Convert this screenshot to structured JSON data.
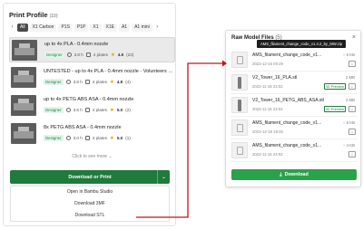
{
  "print_profile": {
    "title": "Print Profile",
    "count": "(10)",
    "filters": [
      "All",
      "X1 Carbon",
      "P1S",
      "P1P",
      "X1",
      "X1E",
      "A1",
      "A1 mini"
    ],
    "items": [
      {
        "title": "up to 4x PLA - 0.4mm nozzle",
        "badge": "Designer",
        "time": "3.8 h",
        "plates": "4 plates",
        "rating": "4.9",
        "rating_count": "(23)"
      },
      {
        "title": "UNTESTED - up to 4x PLA - 0.4mm nozzle - Volunteers wan...",
        "badge": "Designer",
        "time": "3.8 h",
        "plates": "4 plates",
        "rating": "4.8",
        "rating_count": "(4)"
      },
      {
        "title": "up to 4x PETG ABS ASA - 0.4mm nozzle",
        "badge": "Designer",
        "time": "3.6 h",
        "plates": "4 plates",
        "rating": "5.0",
        "rating_count": "(2)"
      },
      {
        "title": "8x PETG ABS ASA - 0.4mm nozzle",
        "badge": "Designer",
        "time": "3.0 h",
        "plates": "4 plates",
        "rating": "5.0",
        "rating_count": "(1)"
      }
    ],
    "click_more": "Click to see more",
    "download_print": "Download or Print",
    "menu": [
      "Open in Bambu Studio",
      "Download 3MF",
      "Download STL"
    ]
  },
  "raw_model_files": {
    "title": "Raw Model Files",
    "count": "(5)",
    "tooltip": "AMS_filament_change_code_v1.4.2_by_MW.zip",
    "files": [
      {
        "name": "AMS_filament_change_code_v1...",
        "date": "2023-12-16 00:29",
        "size": "5 KB",
        "preview": ""
      },
      {
        "name": "V2_Tower_16_PLA.stl",
        "date": "2023-11-16 23:02",
        "size": "2 MB",
        "preview": "3D Preview"
      },
      {
        "name": "V2_Tower_16_PETG_ABS_ASA.stl",
        "date": "2023-11-16 23:02",
        "size": "2 MB",
        "preview": "3D Preview"
      },
      {
        "name": "AMS_filament_change_code_v1...",
        "date": "2023-12-18 19:46",
        "size": "5 KB",
        "preview": ""
      },
      {
        "name": "AMS_filament_change_code_v1...",
        "date": "2023-11-16 23:02",
        "size": "4 KB",
        "preview": ""
      }
    ],
    "download": "Download"
  },
  "colors": {
    "accent_dark_green": "#1f7a3b",
    "accent_green": "#2aa14b",
    "connector_red": "#c0151a"
  }
}
